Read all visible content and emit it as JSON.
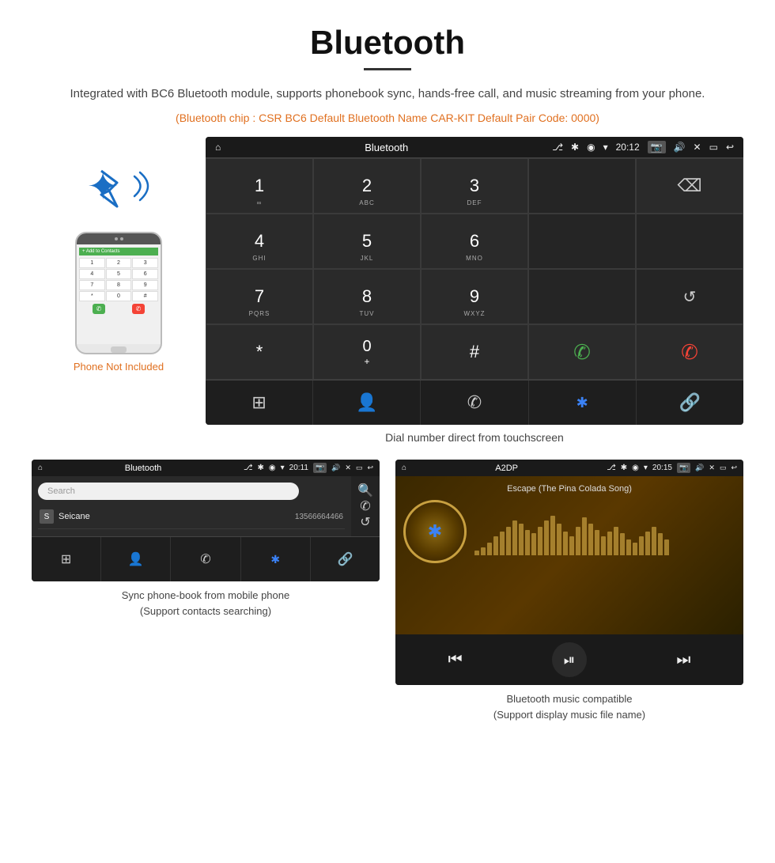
{
  "page": {
    "title": "Bluetooth",
    "subtitle": "Integrated with BC6 Bluetooth module, supports phonebook sync, hands-free call, and music streaming from your phone.",
    "orange_info": "(Bluetooth chip : CSR BC6    Default Bluetooth Name CAR-KIT    Default Pair Code: 0000)",
    "dial_caption": "Dial number direct from touchscreen",
    "phone_not_included": "Phone Not Included",
    "phonebook_caption": "Sync phone-book from mobile phone\n(Support contacts searching)",
    "music_caption": "Bluetooth music compatible\n(Support display music file name)"
  },
  "car_screen": {
    "status_bar": {
      "home_icon": "⌂",
      "title": "Bluetooth",
      "usb_icon": "⎇",
      "time": "20:12",
      "icons": [
        "📷",
        "🔊",
        "✕",
        "▭",
        "↩"
      ]
    },
    "dial_keys": [
      {
        "label": "1",
        "sub": "∞",
        "col": 1
      },
      {
        "label": "2",
        "sub": "ABC",
        "col": 2
      },
      {
        "label": "3",
        "sub": "DEF",
        "col": 3
      },
      {
        "label": "",
        "sub": "",
        "col": 4,
        "empty": true
      },
      {
        "label": "⌫",
        "sub": "",
        "col": 5,
        "backspace": true
      },
      {
        "label": "4",
        "sub": "GHI",
        "col": 1
      },
      {
        "label": "5",
        "sub": "JKL",
        "col": 2
      },
      {
        "label": "6",
        "sub": "MNO",
        "col": 3
      },
      {
        "label": "",
        "sub": "",
        "col": 4,
        "empty": true
      },
      {
        "label": "",
        "sub": "",
        "col": 5,
        "empty": true
      },
      {
        "label": "7",
        "sub": "PQRS",
        "col": 1
      },
      {
        "label": "8",
        "sub": "TUV",
        "col": 2
      },
      {
        "label": "9",
        "sub": "WXYZ",
        "col": 3
      },
      {
        "label": "",
        "sub": "",
        "col": 4,
        "empty": true
      },
      {
        "label": "↺",
        "sub": "",
        "col": 5
      },
      {
        "label": "*",
        "sub": "",
        "col": 1
      },
      {
        "label": "0",
        "sub": "+",
        "col": 2
      },
      {
        "label": "#",
        "sub": "",
        "col": 3
      },
      {
        "label": "✆",
        "sub": "",
        "col": 4,
        "green": true
      },
      {
        "label": "✆",
        "sub": "",
        "col": 5,
        "red": true
      }
    ],
    "bottom_nav": [
      "⊞",
      "👤",
      "✆",
      "✱",
      "🔗"
    ]
  },
  "phonebook_screen": {
    "title": "Bluetooth",
    "time": "20:11",
    "search_placeholder": "Search",
    "contacts": [
      {
        "letter": "S",
        "name": "Seicane",
        "number": "13566664466"
      }
    ],
    "right_icons": [
      "🔍",
      "✆",
      "↺"
    ]
  },
  "music_screen": {
    "title": "A2DP",
    "time": "20:15",
    "song_title": "Escape (The Pina Colada Song)",
    "controls": [
      "⏮",
      "⏯",
      "⏭"
    ]
  },
  "viz_bars": [
    3,
    5,
    8,
    12,
    15,
    18,
    22,
    20,
    16,
    14,
    18,
    22,
    25,
    20,
    15,
    12,
    18,
    24,
    20,
    16,
    12,
    15,
    18,
    14,
    10,
    8,
    12,
    15,
    18,
    14,
    10
  ]
}
